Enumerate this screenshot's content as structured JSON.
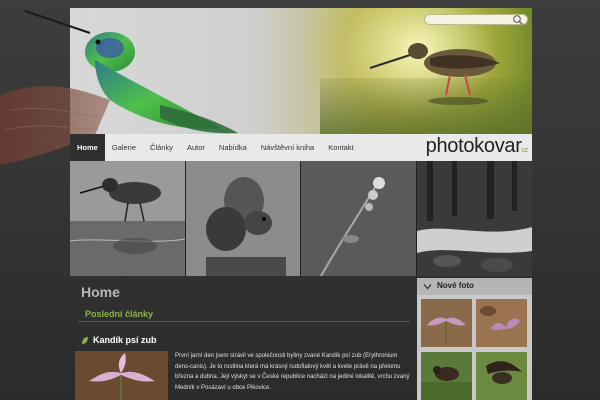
{
  "header": {
    "search": {
      "placeholder": ""
    },
    "logo": {
      "main": "photokovar",
      "tld": "cz"
    }
  },
  "nav": {
    "items": [
      {
        "label": "Home",
        "active": true
      },
      {
        "label": "Galerie"
      },
      {
        "label": "Články"
      },
      {
        "label": "Autor"
      },
      {
        "label": "Nabídka"
      },
      {
        "label": "Návštěvní kniha"
      },
      {
        "label": "Kontakt"
      }
    ]
  },
  "main": {
    "title": "Home",
    "section_heading": "Poslední články",
    "article": {
      "title": "Kandík psí zub",
      "text": "První jarní den jsem strávil ve společnosti byliny zvané Kandík psí zub (Erythronium dens-canis). Je to rostlina která má krásný rudofialový květ a kvete právě na přelomu března a dubna. Její výskyt se v České republice nachází na jediné lokalitě, vrchu zvaný Medník v Posázaví u obce Pikovice."
    }
  },
  "sidebar": {
    "new_photo_title": "Nové foto"
  },
  "colors": {
    "nav_active_bg": "#2f2f2f",
    "section_green": "#8db24a",
    "page_bg": "#333333"
  },
  "icons": [
    "search-icon",
    "chevron-down-icon",
    "leaf-icon"
  ]
}
